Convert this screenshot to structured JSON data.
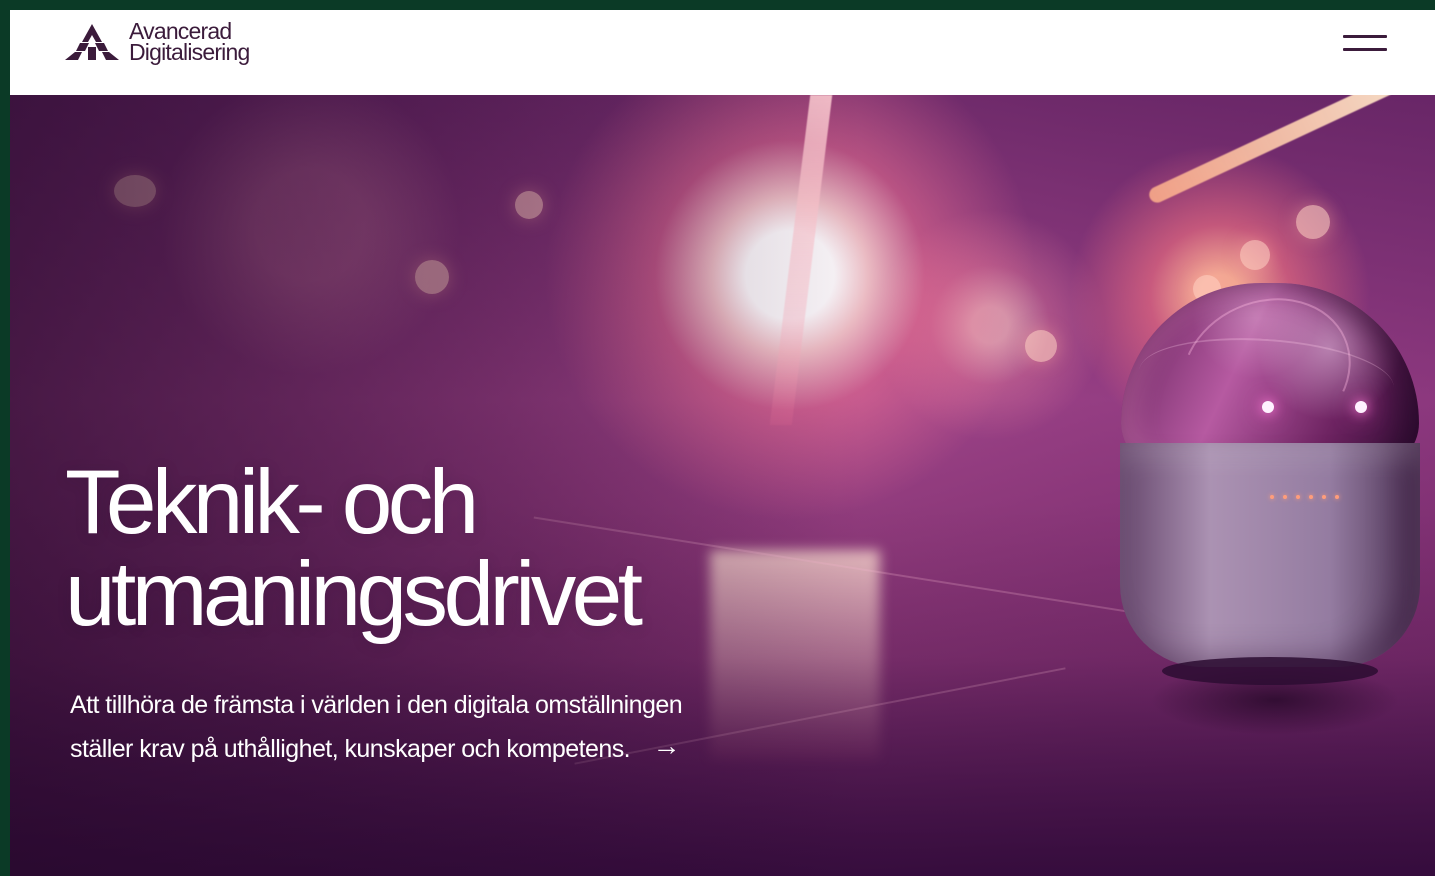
{
  "brand": {
    "name_line_1": "Avancerad",
    "name_line_2": "Digitalisering",
    "logo_icon": "abstract-a-logo",
    "color": "#3b1b3b"
  },
  "navigation": {
    "menu_icon": "hamburger-menu-icon"
  },
  "hero": {
    "title_line_1": "Teknik- och",
    "title_line_2": "utmaningsdrivet",
    "description": "Att tillhöra de främsta i världen i den digitala omställningen ställer krav på uthållighet, kunskaper och kompetens.",
    "arrow": "→",
    "arrow_icon": "arrow-right-icon",
    "image": "pink-lit-robot-on-reflective-floor"
  },
  "colors": {
    "outer_frame": "#0b3a26",
    "header_background": "#ffffff",
    "hero_text": "#ffffff",
    "hero_magenta": "#82366d"
  }
}
